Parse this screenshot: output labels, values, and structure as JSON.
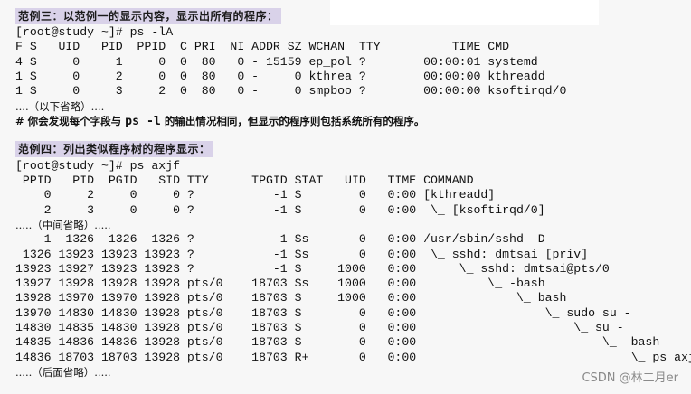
{
  "example3": {
    "heading": "范例三：以范例一的显示内容，显示出所有的程序：",
    "command": "[root@study ~]# ps -lA",
    "header": "F S   UID   PID  PPID  C PRI  NI ADDR SZ WCHAN  TTY          TIME CMD",
    "rows": [
      "4 S     0     1     0  0  80   0 - 15159 ep_pol ?        00:00:01 systemd",
      "1 S     0     2     0  0  80   0 -     0 kthrea ?        00:00:00 kthreadd",
      "1 S     0     3     2  0  80   0 -     0 smpboo ?        00:00:00 ksoftirqd/0"
    ],
    "omitted": "....（以下省略）....",
    "note_prefix": "# 你会发现每个字段与 ",
    "note_cmd": "ps -l",
    "note_suffix": " 的输出情况相同，但显示的程序则包括系统所有的程序。"
  },
  "example4": {
    "heading": "范例四：列出类似程序树的程序显示：",
    "command": "[root@study ~]# ps axjf",
    "header": " PPID   PID  PGID   SID TTY      TPGID STAT   UID   TIME COMMAND",
    "rows_a": [
      "    0     2     0     0 ?           -1 S        0   0:00 [kthreadd]",
      "    2     3     0     0 ?           -1 S        0   0:00  \\_ [ksoftirqd/0]"
    ],
    "omitted_mid": ".....（中间省略）.....",
    "rows_b": [
      "    1  1326  1326  1326 ?           -1 Ss       0   0:00 /usr/sbin/sshd -D",
      " 1326 13923 13923 13923 ?           -1 Ss       0   0:00  \\_ sshd: dmtsai [priv]",
      "13923 13927 13923 13923 ?           -1 S     1000   0:00      \\_ sshd: dmtsai@pts/0",
      "13927 13928 13928 13928 pts/0    18703 Ss    1000   0:00          \\_ -bash",
      "13928 13970 13970 13928 pts/0    18703 S     1000   0:00              \\_ bash",
      "13970 14830 14830 13928 pts/0    18703 S        0   0:00                  \\_ sudo su -",
      "14830 14835 14830 13928 pts/0    18703 S        0   0:00                      \\_ su -",
      "14835 14836 14836 13928 pts/0    18703 S        0   0:00                          \\_ -bash",
      "14836 18703 18703 13928 pts/0    18703 R+       0   0:00                              \\_ ps axjf"
    ],
    "omitted_end": ".....（后面省略）....."
  },
  "watermark": "CSDN @林二月er"
}
